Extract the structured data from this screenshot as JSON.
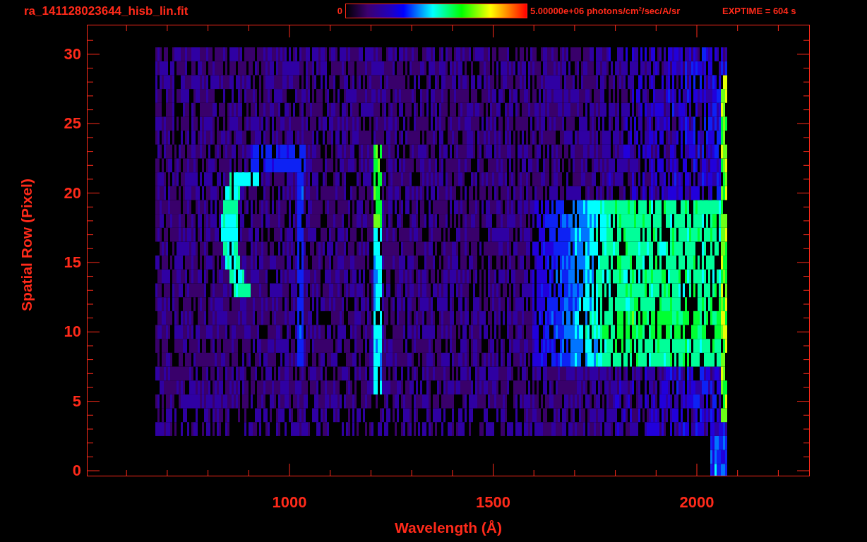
{
  "title": "ra_141128023644_hisb_lin.fit",
  "colorbar": {
    "min_label": "0",
    "max_label": "5.00000e+06 photons/cm$^{2}$/sec/A/sr"
  },
  "exposure": "EXPTIME = 604 s",
  "plot": {
    "ylabel": "Spatial Row (Pixel)",
    "xlabel": "Wavelength (Å)",
    "yticks": [
      "30",
      "25",
      "20",
      "15",
      "10",
      "5",
      "0"
    ],
    "xticks": [
      "1000",
      "1500",
      "2000"
    ]
  }
}
